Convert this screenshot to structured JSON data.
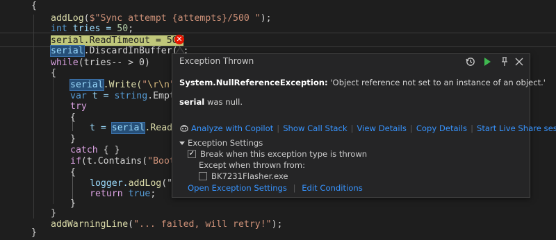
{
  "code": {
    "l0": "{",
    "l1_fn": "addLog",
    "l1_str": "$\"Sync attempt {attempts}/500 \"",
    "l2_kw": "int",
    "l2_rest": " tries = ",
    "l2_num": "50",
    "l3_stmt": "serial.ReadTimeout = 50;",
    "l4_var": "serial",
    "l4_rest": ".DiscardInBuffer();",
    "l5_kw": "while",
    "l5_rest": "(tries-- > 0)",
    "l6": "{",
    "l7_var": "serial",
    "l7_fn": ".Write(",
    "l7_str": "\"",
    "l7_esc": "\\r\\n",
    "l7_str2": "\"",
    "l7_rest": ");",
    "l8_kw": "var",
    "l8_rest": " t = ",
    "l8_kw2": "string",
    "l8_rest2": ".Empty;",
    "l9_kw": "try",
    "l10": "{",
    "l11_a": "t = ",
    "l11_var": "serial",
    "l11_b": ".ReadLi",
    "l12": "}",
    "l13_kw": "catch",
    "l13_rest": " { }",
    "l14_kw": "if",
    "l14_rest": "(t.Contains(",
    "l14_str": "\"Boot >",
    "l15": "{",
    "l16_a": "logger.",
    "l16_fn": "addLog",
    "l16_b": "(\"...",
    "l17_kw": "return",
    "l17_kw2": "true",
    "l17_rest": ";",
    "l18": "}",
    "l19": "}",
    "l20_fn": "addWarningLine",
    "l20_str": "\"... failed, will retry!\"",
    "l20_rest": ");",
    "l21": "}"
  },
  "exception": {
    "title": "Exception Thrown",
    "type": "System.NullReferenceException:",
    "message": "'Object reference not set to an instance of an object.'",
    "null_var": "serial",
    "null_text": "was null.",
    "links": {
      "copilot": "Analyze with Copilot",
      "call_stack": "Show Call Stack",
      "view_details": "View Details",
      "copy_details": "Copy Details",
      "live_share": "Start Live Share session..."
    },
    "settings_title": "Exception Settings",
    "break_label": "Break when this exception type is thrown",
    "break_checked": true,
    "except_label": "Except when thrown from:",
    "module_label": "BK7231Flasher.exe",
    "module_checked": false,
    "open_settings": "Open Exception Settings",
    "edit_conditions": "Edit Conditions"
  },
  "icons": {
    "history": "history-icon",
    "continue": "continue-icon",
    "pin": "pin-icon",
    "close": "close-icon",
    "error": "error-icon",
    "copilot": "copilot-icon"
  },
  "colors": {
    "link": "#3794ff",
    "continue": "#3fb950",
    "error": "#e51400",
    "statement_highlight": "#c0c77a"
  }
}
